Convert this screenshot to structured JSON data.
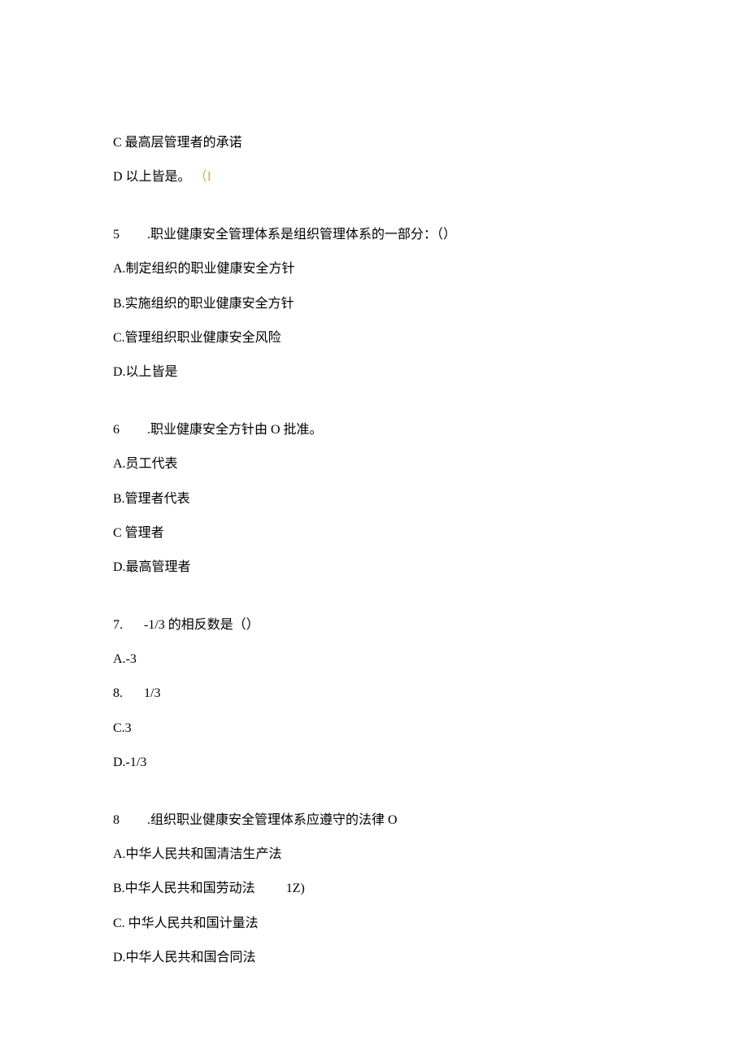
{
  "q4": {
    "optC": "C 最高层管理者的承诺",
    "optD_prefix": "D 以上皆是。",
    "optD_orange": "（I"
  },
  "q5": {
    "num": "5",
    "title": ".职业健康安全管理体系是组织管理体系的一部分：（）",
    "optA": "A.制定组织的职业健康安全方针",
    "optB": "B.实施组织的职业健康安全方针",
    "optC": "C.管理组织职业健康安全风险",
    "optD": "D.以上皆是"
  },
  "q6": {
    "num": "6",
    "title": ".职业健康安全方针由 O 批准。",
    "optA": "A.员工代表",
    "optB": "B.管理者代表",
    "optC": "C 管理者",
    "optD": "D.最高管理者"
  },
  "q7": {
    "num": "7.",
    "title": "-1/3 的相反数是（）",
    "optA": "A.-3",
    "optB_num": "8.",
    "optB_text": "1/3",
    "optC": "C.3",
    "optD": "D.-1/3"
  },
  "q8": {
    "num": "8",
    "title": ".组织职业健康安全管理体系应遵守的法律 O",
    "optA": "A.中华人民共和国清洁生产法",
    "optB_main": "B.中华人民共和国劳动法",
    "optB_extra": "1Z)",
    "optC": "C. 中华人民共和国计量法",
    "optD": "D.中华人民共和国合同法"
  }
}
